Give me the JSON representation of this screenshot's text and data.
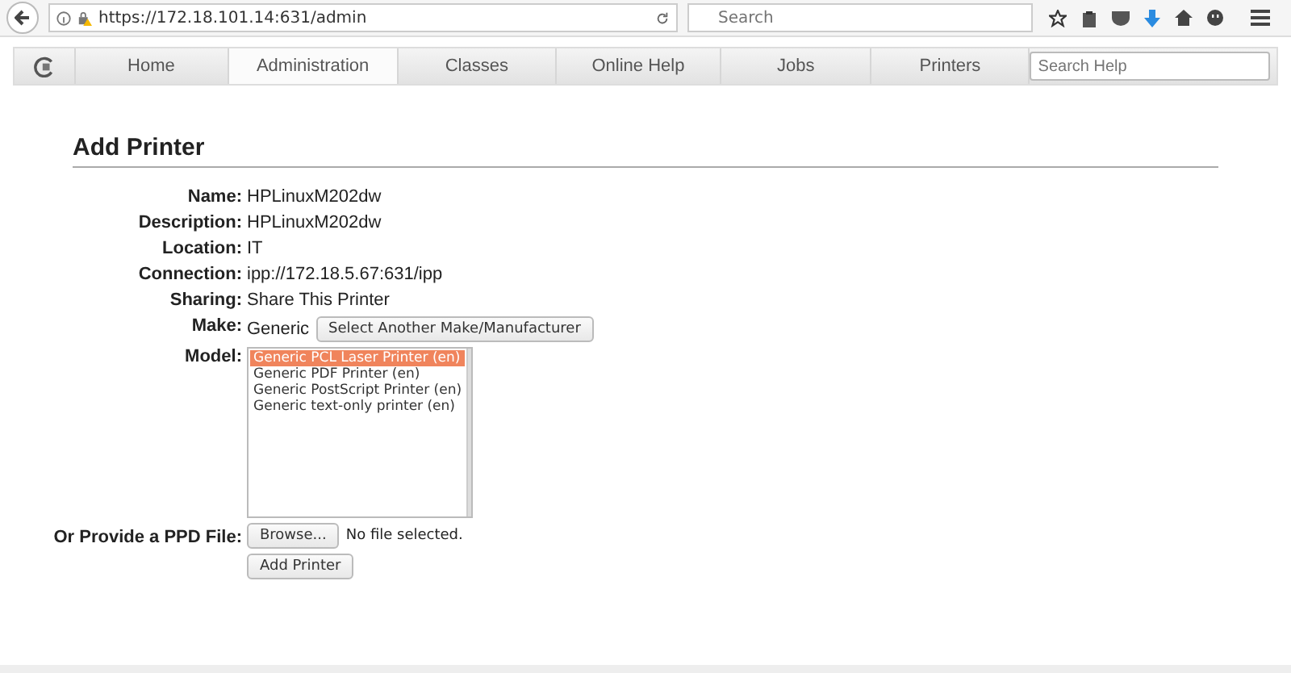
{
  "browser": {
    "url": "https://172.18.101.14:631/admin",
    "search_placeholder": "Search"
  },
  "nav": {
    "tabs": [
      {
        "label": "Home",
        "selected": false
      },
      {
        "label": "Administration",
        "selected": true
      },
      {
        "label": "Classes",
        "selected": false
      },
      {
        "label": "Online Help",
        "selected": false
      },
      {
        "label": "Jobs",
        "selected": false
      },
      {
        "label": "Printers",
        "selected": false
      }
    ],
    "search_placeholder": "Search Help"
  },
  "heading": "Add Printer",
  "fields": [
    {
      "label": "Name:",
      "value": "HPLinuxM202dw"
    },
    {
      "label": "Description:",
      "value": "HPLinuxM202dw"
    },
    {
      "label": "Location:",
      "value": "IT"
    },
    {
      "label": "Connection:",
      "value": "ipp://172.18.5.67:631/ipp"
    },
    {
      "label": "Sharing:",
      "value": "Share This Printer"
    }
  ],
  "make": {
    "label": "Make:",
    "value": "Generic",
    "button": "Select Another Make/Manufacturer"
  },
  "model": {
    "label": "Model:",
    "options": [
      {
        "label": "Generic PCL Laser Printer (en)",
        "selected": true
      },
      {
        "label": "Generic PDF Printer (en)",
        "selected": false
      },
      {
        "label": "Generic PostScript Printer (en)",
        "selected": false
      },
      {
        "label": "Generic text-only printer (en)",
        "selected": false
      }
    ]
  },
  "ppd": {
    "label": "Or Provide a PPD File:",
    "browse": "Browse...",
    "status": "No file selected."
  },
  "submit": "Add Printer"
}
